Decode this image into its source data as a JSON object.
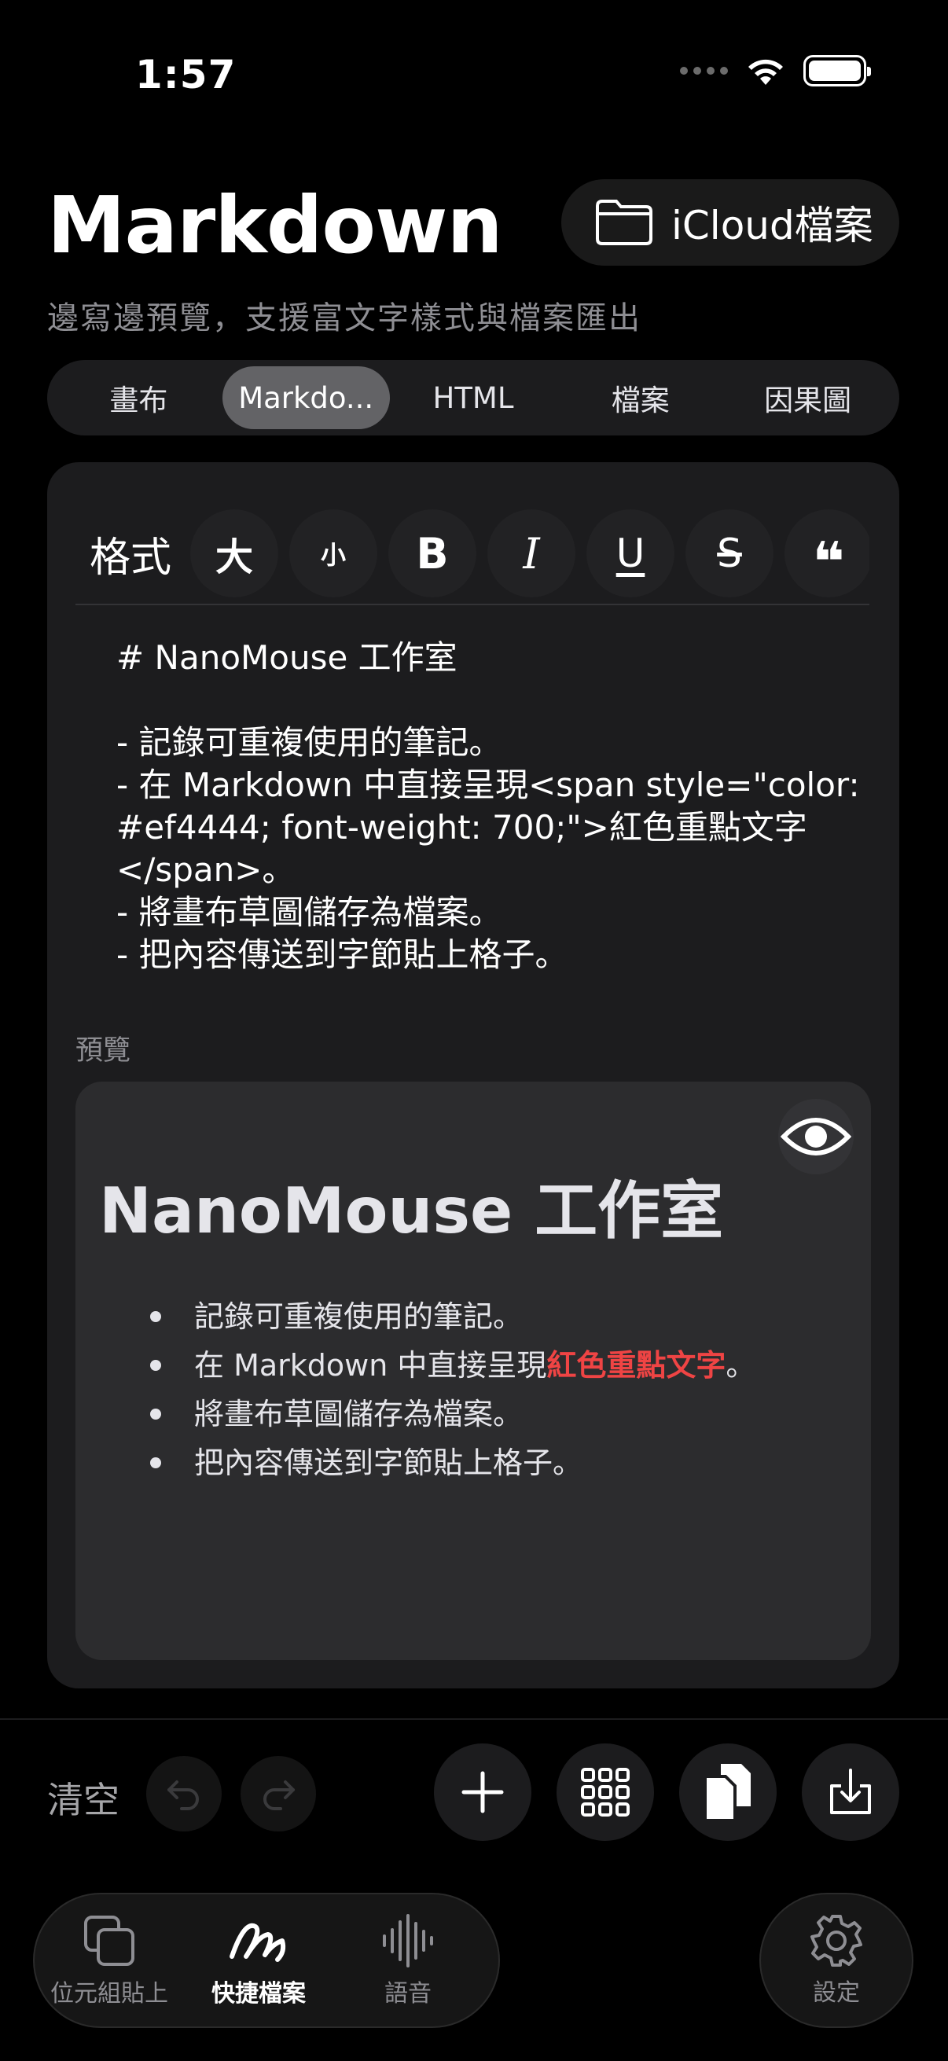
{
  "status_bar": {
    "time": "1:57"
  },
  "header": {
    "title": "Markdown",
    "subtitle": "邊寫邊預覽，支援富文字樣式與檔案匯出",
    "icloud_button": "iCloud檔案"
  },
  "tabs": [
    {
      "label": "畫布"
    },
    {
      "label": "Markdo..."
    },
    {
      "label": "HTML"
    },
    {
      "label": "檔案"
    },
    {
      "label": "因果圖"
    }
  ],
  "active_tab": "Markdo...",
  "toolbar": {
    "format_label": "格式",
    "buttons": [
      {
        "label": "大",
        "icon": "text-large-icon"
      },
      {
        "label": "小",
        "icon": "text-small-icon"
      },
      {
        "label": "B",
        "icon": "bold-icon"
      },
      {
        "label": "I",
        "icon": "italic-icon"
      },
      {
        "label": "U",
        "icon": "underline-icon"
      },
      {
        "label": "S",
        "icon": "strikethrough-icon"
      },
      {
        "label": "❝",
        "icon": "quote-icon"
      }
    ]
  },
  "editor": {
    "content": "# NanoMouse 工作室\n\n- 記錄可重複使用的筆記。\n- 在 Markdown 中直接呈現<span style=\"color: #ef4444; font-weight: 700;\">紅色重點文字</span>。\n- 將畫布草圖儲存為檔案。\n- 把內容傳送到字節貼上格子。"
  },
  "preview": {
    "label": "預覽",
    "heading": "NanoMouse 工作室",
    "items": [
      {
        "text": "記錄可重複使用的筆記。"
      },
      {
        "before": "在 Markdown 中直接呈現",
        "highlight": "紅色重點文字",
        "after": "。"
      },
      {
        "text": "將畫布草圖儲存為檔案。"
      },
      {
        "text": "把內容傳送到字節貼上格子。"
      }
    ],
    "highlight_color": "#ef4444"
  },
  "actions": {
    "clear": "清空",
    "icons": [
      "undo-icon",
      "redo-icon",
      "add-icon",
      "grid-icon",
      "copy-icon",
      "download-icon"
    ]
  },
  "tabbar": {
    "items": [
      {
        "label": "位元組貼上",
        "icon": "copy-squares-icon"
      },
      {
        "label": "快捷檔案",
        "icon": "scribble-icon"
      },
      {
        "label": "語音",
        "icon": "waveform-icon"
      }
    ],
    "settings": "設定"
  },
  "colors": {
    "accent": "#ef4444",
    "background": "#000000",
    "card": "#1c1c1e"
  }
}
